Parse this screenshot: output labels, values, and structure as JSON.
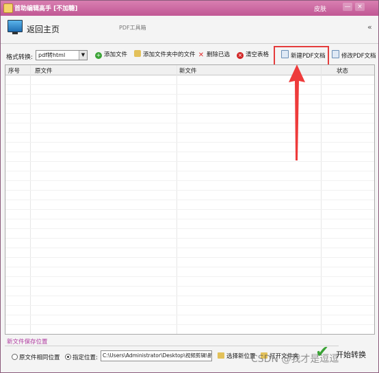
{
  "window": {
    "title": "首助编辑高手 [不加糖]",
    "skin_label": "皮肤",
    "controls": [
      "—",
      "×"
    ]
  },
  "header": {
    "home_label": "返回主页",
    "toolbox_title": "PDF工具箱",
    "collapse_glyph": "«"
  },
  "toolbar": {
    "format_label": "格式转换:",
    "format_value": "pdf转html",
    "add_file": "添加文件",
    "add_folder": "添加文件夹中的文件",
    "delete_selected": "删除已选",
    "clear_table": "清空表格",
    "new_pdf": "新建PDF文档",
    "edit_pdf": "修改PDF文档"
  },
  "table": {
    "columns": [
      "序号",
      "原文件",
      "新文件",
      "状态"
    ],
    "rows": []
  },
  "save": {
    "section_title": "新文件保存位置",
    "same_location": "原文件相同位置",
    "specified_location": "指定位置:",
    "path": "C:\\Users\\Administrator\\Desktop\\视频剪辑\\新",
    "choose_location": "选择新位置",
    "open_folder": "打开文件夹"
  },
  "actions": {
    "start_convert": "开始转换"
  },
  "watermark": "CSDN @我才是逗逗",
  "colors": {
    "titlebar": "#c05794",
    "highlight": "#e53b3b",
    "arrow": "#ee3b3b",
    "section_title": "#b03ca0",
    "check": "#3aa335"
  }
}
